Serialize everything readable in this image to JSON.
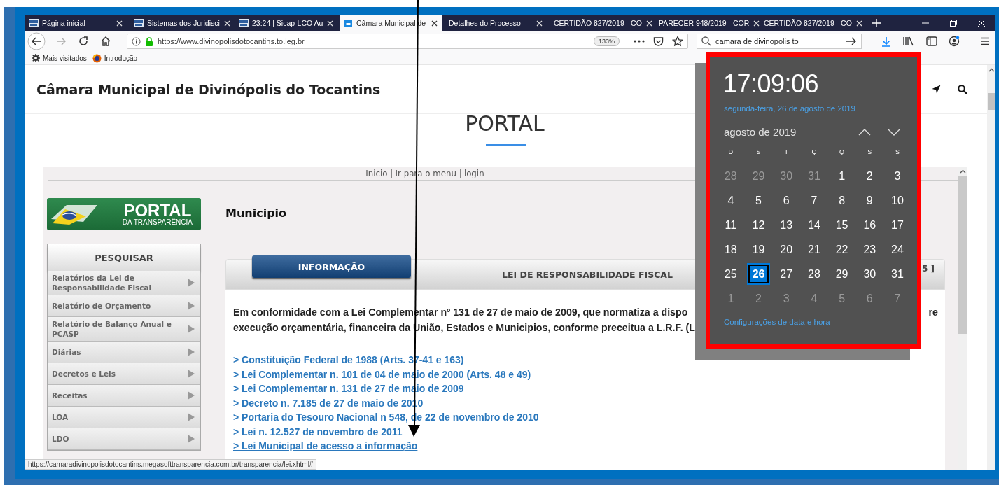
{
  "browser": {
    "tabs": [
      {
        "label": "Página inicial",
        "selected": false
      },
      {
        "label": "Sistemas dos Juridisci",
        "selected": false
      },
      {
        "label": "23:24 | Sicap-LCO Au",
        "selected": false
      },
      {
        "label": "Câmara Municipal de",
        "selected": true
      },
      {
        "label": "Detalhes do Processo",
        "selected": false
      },
      {
        "label": "CERTIDÃO 827/2019 - CO",
        "selected": false
      },
      {
        "label": "PARECER 948/2019 - COR",
        "selected": false
      },
      {
        "label": "CERTIDÃO 827/2019 - CO",
        "selected": false
      }
    ],
    "url": "https://www.divinopolisdotocantins.to.leg.br",
    "zoom": "133%",
    "search_value": "camara de divinopolis to",
    "bookmarks": [
      {
        "label": "Mais visitados"
      },
      {
        "label": "Introdução"
      }
    ],
    "status_url": "https://camaradivinopolisdotocantins.megasofttransparencia.com.br/transparencia/lei.xhtml#"
  },
  "site": {
    "title": "Câmara Municipal de Divinópolis do Tocantins",
    "heading": "PORTAL"
  },
  "portal": {
    "top_links": [
      "Inicio",
      "Ir para o menu",
      "login"
    ],
    "logo": {
      "title": "PORTAL",
      "subtitle": "DA TRANSPARÊNCIA"
    },
    "menu": {
      "header": "PESQUISAR",
      "items": [
        "Relatórios da Lei de Responsabilidade Fiscal",
        "Relatório de Orçamento",
        "Relatório de Balanço Anual e PCASP",
        "Diárias",
        "Decretos e Leis",
        "Receitas",
        "LOA",
        "LDO"
      ]
    },
    "section_title": "Municipio",
    "tabs": [
      {
        "label": "INFORMAÇÃO",
        "selected": true
      },
      {
        "label": "LEI DE RESPONSABILIDADE FISCAL",
        "selected": false
      }
    ],
    "tab_bar_end": "5 ]",
    "intro_lines": [
      "Em conformidade com a Lei Complementar nº 131 de 27 de maio de 2009, que normatiza a dispo",
      "execução orçamentária, financeira da União, Estados e Municipios, conforme preceitua a L.R.F. (L"
    ],
    "intro_right": "re",
    "links": [
      {
        "text": "> Constituição Federal de 1988 (Arts. 37-41 e 163)",
        "hovered": false
      },
      {
        "text": "> Lei Complementar n. 101 de 04 de maio de 2000 (Arts. 48 e 49)",
        "hovered": false
      },
      {
        "text": "> Lei Complementar n. 131 de 27 de maio de 2009",
        "hovered": false
      },
      {
        "text": "> Decreto n. 7.185 de 27 de maio de 2010",
        "hovered": false
      },
      {
        "text": "> Portaria do Tesouro Nacional n 548, de 22 de novembro de 2010",
        "hovered": false
      },
      {
        "text": "> Lei n. 12.527 de novembro de 2011",
        "hovered": false
      },
      {
        "text": "> Lei Municipal de acesso a informação",
        "hovered": true
      }
    ]
  },
  "clock": {
    "time": "17:09:06",
    "date": "segunda-feira, 26 de agosto de 2019",
    "month": "agosto de 2019",
    "weekdays": [
      "D",
      "S",
      "T",
      "Q",
      "Q",
      "S",
      "S"
    ],
    "days": [
      {
        "label": "28",
        "in_month": false,
        "selected": false
      },
      {
        "label": "29",
        "in_month": false,
        "selected": false
      },
      {
        "label": "30",
        "in_month": false,
        "selected": false
      },
      {
        "label": "31",
        "in_month": false,
        "selected": false
      },
      {
        "label": "1",
        "in_month": true,
        "selected": false
      },
      {
        "label": "2",
        "in_month": true,
        "selected": false
      },
      {
        "label": "3",
        "in_month": true,
        "selected": false
      },
      {
        "label": "4",
        "in_month": true,
        "selected": false
      },
      {
        "label": "5",
        "in_month": true,
        "selected": false
      },
      {
        "label": "6",
        "in_month": true,
        "selected": false
      },
      {
        "label": "7",
        "in_month": true,
        "selected": false
      },
      {
        "label": "8",
        "in_month": true,
        "selected": false
      },
      {
        "label": "9",
        "in_month": true,
        "selected": false
      },
      {
        "label": "10",
        "in_month": true,
        "selected": false
      },
      {
        "label": "11",
        "in_month": true,
        "selected": false
      },
      {
        "label": "12",
        "in_month": true,
        "selected": false
      },
      {
        "label": "13",
        "in_month": true,
        "selected": false
      },
      {
        "label": "14",
        "in_month": true,
        "selected": false
      },
      {
        "label": "15",
        "in_month": true,
        "selected": false
      },
      {
        "label": "16",
        "in_month": true,
        "selected": false
      },
      {
        "label": "17",
        "in_month": true,
        "selected": false
      },
      {
        "label": "18",
        "in_month": true,
        "selected": false
      },
      {
        "label": "19",
        "in_month": true,
        "selected": false
      },
      {
        "label": "20",
        "in_month": true,
        "selected": false
      },
      {
        "label": "21",
        "in_month": true,
        "selected": false
      },
      {
        "label": "22",
        "in_month": true,
        "selected": false
      },
      {
        "label": "23",
        "in_month": true,
        "selected": false
      },
      {
        "label": "24",
        "in_month": true,
        "selected": false
      },
      {
        "label": "25",
        "in_month": true,
        "selected": false
      },
      {
        "label": "26",
        "in_month": true,
        "selected": true
      },
      {
        "label": "27",
        "in_month": true,
        "selected": false
      },
      {
        "label": "28",
        "in_month": true,
        "selected": false
      },
      {
        "label": "29",
        "in_month": true,
        "selected": false
      },
      {
        "label": "30",
        "in_month": true,
        "selected": false
      },
      {
        "label": "31",
        "in_month": true,
        "selected": false
      },
      {
        "label": "1",
        "in_month": false,
        "selected": false
      },
      {
        "label": "2",
        "in_month": false,
        "selected": false
      },
      {
        "label": "3",
        "in_month": false,
        "selected": false
      },
      {
        "label": "4",
        "in_month": false,
        "selected": false
      },
      {
        "label": "5",
        "in_month": false,
        "selected": false
      },
      {
        "label": "6",
        "in_month": false,
        "selected": false
      },
      {
        "label": "7",
        "in_month": false,
        "selected": false
      }
    ],
    "settings_link": "Configurações de data e hora"
  }
}
